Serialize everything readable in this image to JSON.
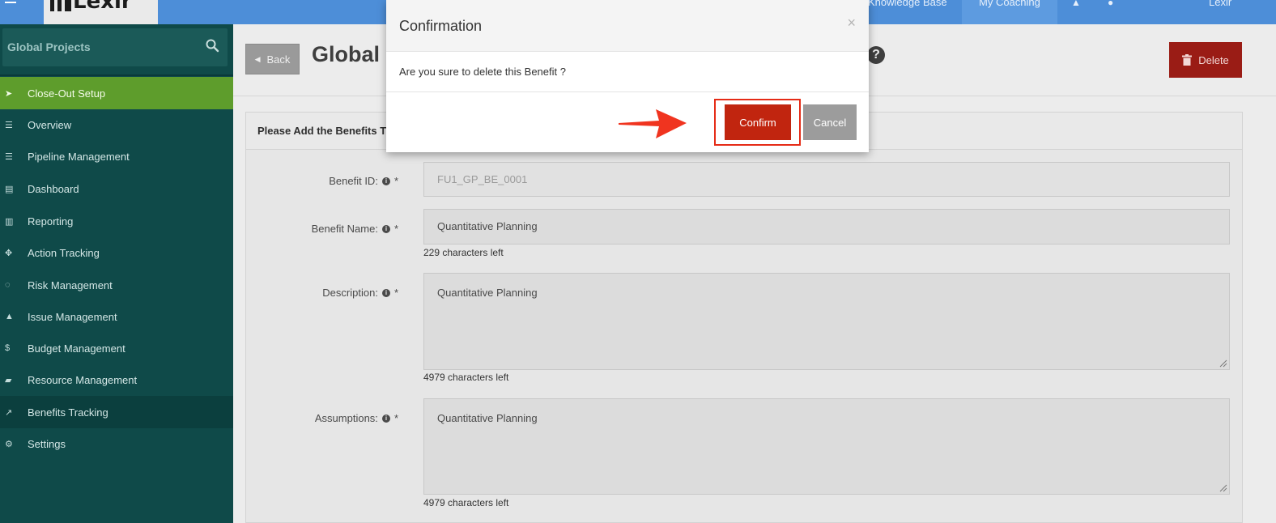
{
  "topbar": {
    "logo_text": "Lexir",
    "links": [
      "Knowledge Base",
      "My Coaching"
    ],
    "user": "Lexir",
    "accent_color": "#4d8ed8"
  },
  "sidebar": {
    "search_label": "Global Projects",
    "items": [
      {
        "label": "Close-Out Setup",
        "icon": "rocket-icon"
      },
      {
        "label": "Overview",
        "icon": "list-icon"
      },
      {
        "label": "Pipeline Management",
        "icon": "list-icon"
      },
      {
        "label": "Dashboard",
        "icon": "dashboard-icon"
      },
      {
        "label": "Reporting",
        "icon": "bar-chart-icon"
      },
      {
        "label": "Action Tracking",
        "icon": "crosshair-icon"
      },
      {
        "label": "Risk Management",
        "icon": "lightbulb-icon"
      },
      {
        "label": "Issue Management",
        "icon": "warning-icon"
      },
      {
        "label": "Budget Management",
        "icon": "dollar-icon"
      },
      {
        "label": "Resource Management",
        "icon": "folder-icon"
      },
      {
        "label": "Benefits Tracking",
        "icon": "line-chart-icon"
      },
      {
        "label": "Settings",
        "icon": "gears-icon"
      }
    ],
    "active_color": "#5e9d2c"
  },
  "header": {
    "back_label": "Back",
    "title": "Global",
    "delete_label": "Delete"
  },
  "form": {
    "panel_title": "Please Add the Benefits Ti",
    "benefit_id_label": "Benefit ID:",
    "benefit_id_value": "FU1_GP_BE_0001",
    "benefit_name_label": "Benefit Name:",
    "benefit_name_value": "Quantitative Planning",
    "benefit_name_hint": "229 characters left",
    "description_label": "Description:",
    "description_value": "Quantitative Planning",
    "description_hint": "4979 characters left",
    "assumptions_label": "Assumptions:",
    "assumptions_value": "Quantitative Planning",
    "assumptions_hint": "4979 characters left",
    "required_mark": "*"
  },
  "modal": {
    "title": "Confirmation",
    "close_glyph": "×",
    "message": "Are you sure to delete this Benefit ?",
    "confirm_label": "Confirm",
    "cancel_label": "Cancel",
    "confirm_color": "#c1250f",
    "highlight_color": "#e52b16"
  }
}
